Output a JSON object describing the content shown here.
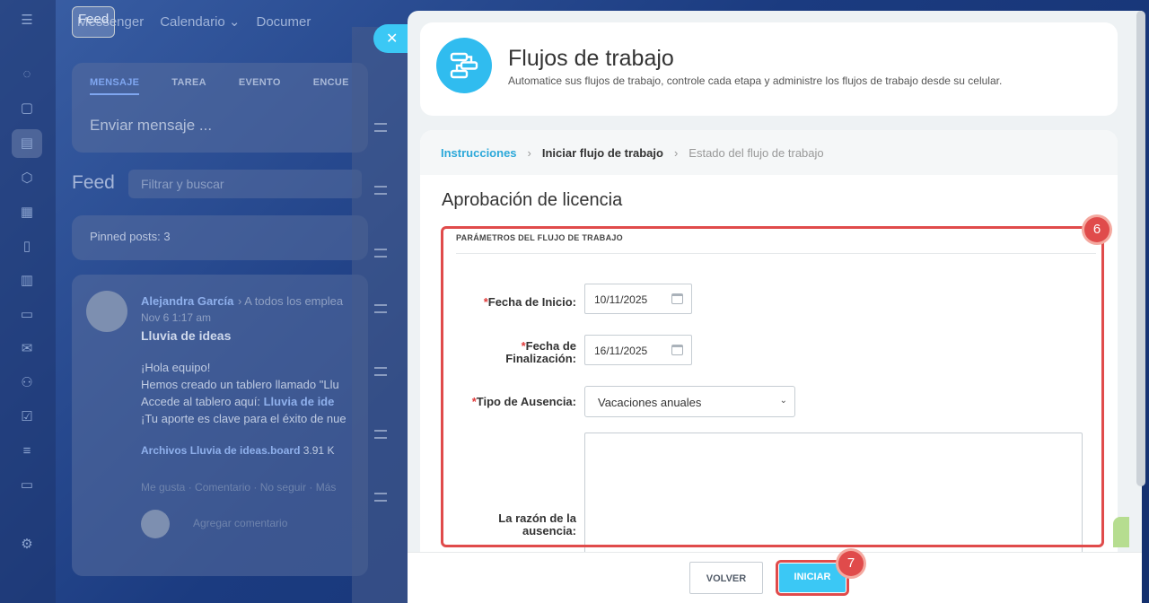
{
  "bg": {
    "nav": [
      "Feed",
      "Messenger",
      "Calendario",
      "Documer"
    ],
    "compose": {
      "tabs": [
        "MENSAJE",
        "TAREA",
        "EVENTO",
        "ENCUE"
      ],
      "placeholder": "Enviar mensaje ..."
    },
    "feed_title": "Feed",
    "search_placeholder": "Filtrar y buscar",
    "pinned": "Pinned posts: 3",
    "post": {
      "author": "Alejandra García",
      "to": "A todos los emplea",
      "date": "Nov 6 1:17 am",
      "title": "Lluvia de ideas",
      "l1": "¡Hola equipo!",
      "l2": "Hemos creado un tablero llamado \"Llu",
      "l3a": "Accede al tablero aquí:",
      "l3b": "Lluvia de ide",
      "l4": "¡Tu aporte es clave para el éxito de nue",
      "files_label": "Archivos",
      "file": "Lluvia de ideas.board",
      "size": "3.91 K",
      "actions": "Me gusta · Comentario · No seguir · Más",
      "comment_ph": "Agregar comentario"
    }
  },
  "header": {
    "title": "Flujos de trabajo",
    "subtitle": "Automatice sus flujos de trabajo, controle cada etapa y administre los flujos de trabajo desde su celular."
  },
  "breadcrumb": [
    "Instrucciones",
    "Iniciar flujo de trabajo",
    "Estado del flujo de trabajo"
  ],
  "form": {
    "title": "Aprobación de licencia",
    "group": "PARÁMETROS DEL FLUJO DE TRABAJO",
    "start_label": "Fecha de Inicio:",
    "start_value": "10/11/2025",
    "end_label_1": "Fecha de",
    "end_label_2": "Finalización:",
    "end_value": "16/11/2025",
    "type_label": "Tipo de Ausencia:",
    "type_value": "Vacaciones anuales",
    "reason_label_1": "La razón de la",
    "reason_label_2": "ausencia:",
    "required_mark": "*"
  },
  "buttons": {
    "back": "VOLVER",
    "start": "INICIAR"
  },
  "annotations": {
    "form_step": "6",
    "button_step": "7",
    "highlight_color": "#e04b4b"
  },
  "colors": {
    "accent": "#3bc8f5",
    "link": "#2ba8d9"
  }
}
